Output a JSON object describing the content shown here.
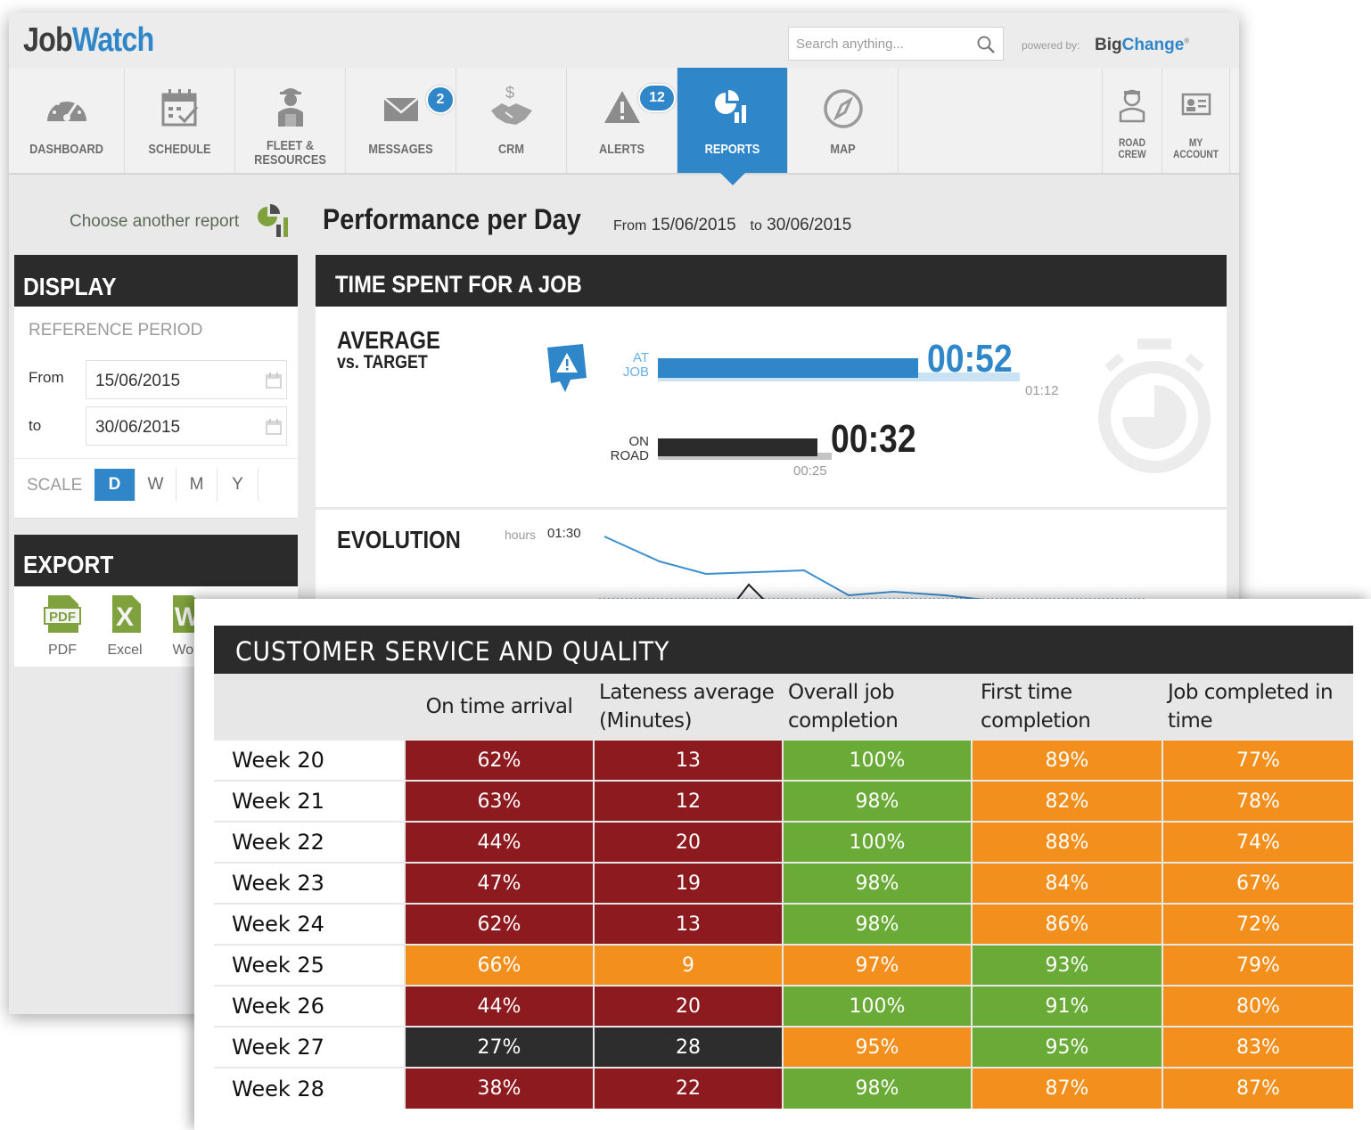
{
  "app": {
    "logo_part1": "Job",
    "logo_part2": "Watch",
    "search_placeholder": "Search anything...",
    "powered_by": "powered by:",
    "brand_part1": "Big",
    "brand_part2": "Change",
    "accent_color": "#2f86c8"
  },
  "nav": {
    "items": [
      {
        "label": "DASHBOARD",
        "icon": "gauge-icon"
      },
      {
        "label": "SCHEDULE",
        "icon": "calendar-icon"
      },
      {
        "label": "FLEET &\nRESOURCES",
        "icon": "engineer-icon"
      },
      {
        "label": "MESSAGES",
        "icon": "envelope-icon",
        "badge": "2"
      },
      {
        "label": "CRM",
        "icon": "handshake-icon"
      },
      {
        "label": "ALERTS",
        "icon": "warning-icon",
        "badge": "12"
      },
      {
        "label": "REPORTS",
        "icon": "pie-chart-icon",
        "active": true
      },
      {
        "label": "MAP",
        "icon": "compass-icon"
      }
    ],
    "right_items": [
      {
        "label": "ROAD\nCREW",
        "icon": "driver-icon"
      },
      {
        "label": "MY\nACCOUNT",
        "icon": "id-card-icon"
      }
    ]
  },
  "report": {
    "choose_label": "Choose another report",
    "title": "Performance per Day",
    "from_label": "From",
    "from_date": "15/06/2015",
    "to_label": "to",
    "to_date": "30/06/2015"
  },
  "display_panel": {
    "heading": "DISPLAY",
    "reference_period": "REFERENCE PERIOD",
    "from_label": "From",
    "from_value": "15/06/2015",
    "to_label": "to",
    "to_value": "30/06/2015",
    "scale_label": "SCALE",
    "scale_options": [
      "D",
      "W",
      "M",
      "Y"
    ],
    "scale_selected": "D"
  },
  "export_panel": {
    "heading": "EXPORT",
    "items": [
      {
        "label": "PDF",
        "icon": "pdf-icon",
        "glyph": "PDF"
      },
      {
        "label": "Excel",
        "icon": "excel-icon",
        "glyph": "X"
      },
      {
        "label": "Wor",
        "icon": "word-icon",
        "glyph": "W"
      }
    ]
  },
  "time_spent": {
    "heading": "TIME SPENT FOR A JOB",
    "avg_title_l1": "AVERAGE",
    "avg_title_l2": "vs. TARGET",
    "at_job_label": "AT\nJOB",
    "at_job_value": "00:52",
    "at_job_target": "01:12",
    "at_job_fraction": 0.72,
    "on_road_label": "ON\nROAD",
    "on_road_value": "00:32",
    "on_road_target": "00:25",
    "on_road_fraction": 0.44,
    "on_road_target_fraction": 0.35
  },
  "evolution": {
    "title": "EVOLUTION",
    "unit": "hours",
    "max_label": "01:30"
  },
  "csq": {
    "heading": "CUSTOMER SERVICE AND QUALITY",
    "columns": [
      "On time arrival",
      "Lateness average (Minutes)",
      "Overall job completion",
      "First time completion",
      "Job completed in time"
    ],
    "status_colors": {
      "red": "#8d1a1f",
      "orange": "#f38f1c",
      "green": "#6aab37",
      "black": "#2d2d2d"
    },
    "rows": [
      {
        "week": "Week 20",
        "cells": [
          [
            "62%",
            "red"
          ],
          [
            "13",
            "red"
          ],
          [
            "100%",
            "green"
          ],
          [
            "89%",
            "orange"
          ],
          [
            "77%",
            "orange"
          ]
        ]
      },
      {
        "week": "Week 21",
        "cells": [
          [
            "63%",
            "red"
          ],
          [
            "12",
            "red"
          ],
          [
            "98%",
            "green"
          ],
          [
            "82%",
            "orange"
          ],
          [
            "78%",
            "orange"
          ]
        ]
      },
      {
        "week": "Week 22",
        "cells": [
          [
            "44%",
            "red"
          ],
          [
            "20",
            "red"
          ],
          [
            "100%",
            "green"
          ],
          [
            "88%",
            "orange"
          ],
          [
            "74%",
            "orange"
          ]
        ]
      },
      {
        "week": "Week 23",
        "cells": [
          [
            "47%",
            "red"
          ],
          [
            "19",
            "red"
          ],
          [
            "98%",
            "green"
          ],
          [
            "84%",
            "orange"
          ],
          [
            "67%",
            "orange"
          ]
        ]
      },
      {
        "week": "Week 24",
        "cells": [
          [
            "62%",
            "red"
          ],
          [
            "13",
            "red"
          ],
          [
            "98%",
            "green"
          ],
          [
            "86%",
            "orange"
          ],
          [
            "72%",
            "orange"
          ]
        ]
      },
      {
        "week": "Week 25",
        "cells": [
          [
            "66%",
            "orange"
          ],
          [
            "9",
            "orange"
          ],
          [
            "97%",
            "orange"
          ],
          [
            "93%",
            "green"
          ],
          [
            "79%",
            "orange"
          ]
        ]
      },
      {
        "week": "Week 26",
        "cells": [
          [
            "44%",
            "red"
          ],
          [
            "20",
            "red"
          ],
          [
            "100%",
            "green"
          ],
          [
            "91%",
            "green"
          ],
          [
            "80%",
            "orange"
          ]
        ]
      },
      {
        "week": "Week 27",
        "cells": [
          [
            "27%",
            "black"
          ],
          [
            "28",
            "black"
          ],
          [
            "95%",
            "orange"
          ],
          [
            "95%",
            "green"
          ],
          [
            "83%",
            "orange"
          ]
        ]
      },
      {
        "week": "Week 28",
        "cells": [
          [
            "38%",
            "red"
          ],
          [
            "22",
            "red"
          ],
          [
            "98%",
            "green"
          ],
          [
            "87%",
            "orange"
          ],
          [
            "87%",
            "orange"
          ]
        ]
      }
    ]
  }
}
